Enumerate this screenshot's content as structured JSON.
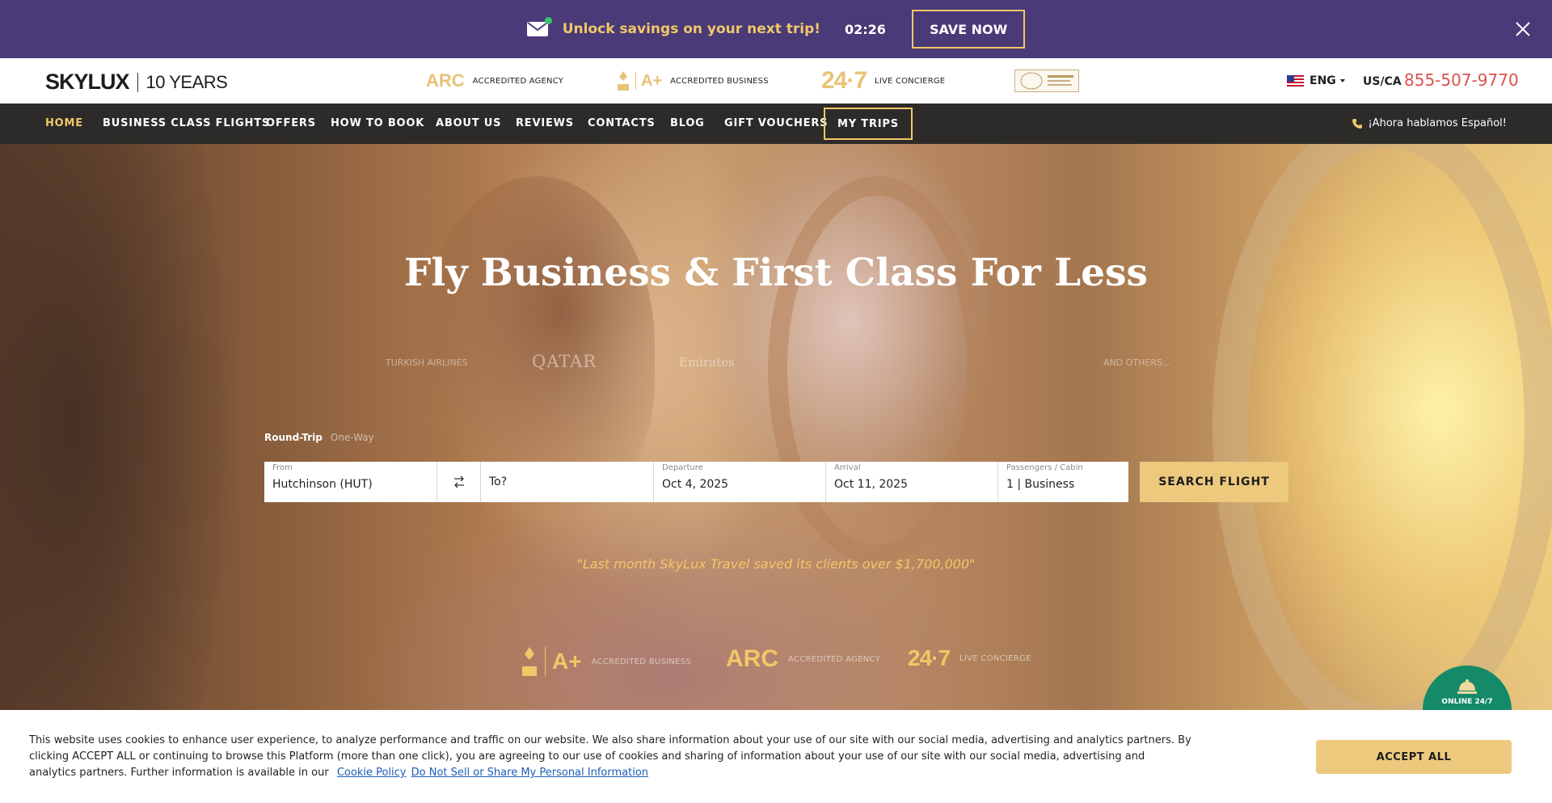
{
  "promo": {
    "message": "Unlock savings on your next trip!",
    "timer": "02:26",
    "cta": "SAVE NOW",
    "icon": "mail-icon"
  },
  "header": {
    "logo": {
      "brand": "SKYLUX",
      "years": "10 YEARS"
    },
    "badges": [
      {
        "mark": "ARC",
        "label": "ACCREDITED AGENCY"
      },
      {
        "mark": "A+",
        "label": "ACCREDITED BUSINESS"
      },
      {
        "mark": "24·7",
        "label": "LIVE CONCIERGE"
      }
    ],
    "language": "ENG",
    "region": "US/CA",
    "phone": "855-507-9770"
  },
  "nav": {
    "items": [
      "HOME",
      "BUSINESS CLASS FLIGHTS",
      "OFFERS",
      "HOW TO BOOK",
      "ABOUT US",
      "REVIEWS",
      "CONTACTS",
      "BLOG",
      "GIFT VOUCHERS"
    ],
    "my_trips": "MY TRIPS",
    "spanish": "¡Ahora hablamos Español!"
  },
  "hero": {
    "title": "Fly Business & First Class For Less",
    "airlines": [
      "TURKISH AIRLINES",
      "QATAR",
      "Emirates",
      "AND OTHERS..."
    ],
    "trip_types": {
      "round_trip": "Round-Trip",
      "one_way": "One-Way"
    },
    "form": {
      "from_label": "From",
      "from_value": "Hutchinson (HUT)",
      "to_value": "To?",
      "departure_label": "Departure",
      "departure_value": "Oct 4, 2025",
      "arrival_label": "Arrival",
      "arrival_value": "Oct 11, 2025",
      "passengers_label": "Passengers / Cabin",
      "passengers_value": "1 | Business",
      "search": "SEARCH FLIGHT"
    },
    "quote": "\"Last month SkyLux Travel saved its clients over $1,700,000\"",
    "trust": [
      {
        "mark": "A+",
        "label": "ACCREDITED BUSINESS"
      },
      {
        "mark": "ARC",
        "label": "ACCREDITED AGENCY"
      },
      {
        "mark": "24·7",
        "label": "LIVE CONCIERGE"
      }
    ],
    "online": "ONLINE 24/7"
  },
  "cookie": {
    "text": "This website uses cookies to enhance user experience, to analyze performance and traffic on our website. We also share information about your use of our site with our social media, advertising and analytics partners. By clicking ACCEPT ALL or continuing to browse this Platform (more than one click), you are agreeing to our use of cookies and sharing of information about your use of our site with our social media, advertising and analytics partners. Further information is available in our",
    "policy_link": "Cookie Policy",
    "dns_link": "Do Not Sell or Share My Personal Information",
    "accept": "ACCEPT ALL"
  },
  "colors": {
    "promo_bg": "#4a3a78",
    "gold": "#f0c868",
    "nav_bg": "#2d2b29",
    "phone": "#d9534f",
    "online": "#158a68"
  }
}
